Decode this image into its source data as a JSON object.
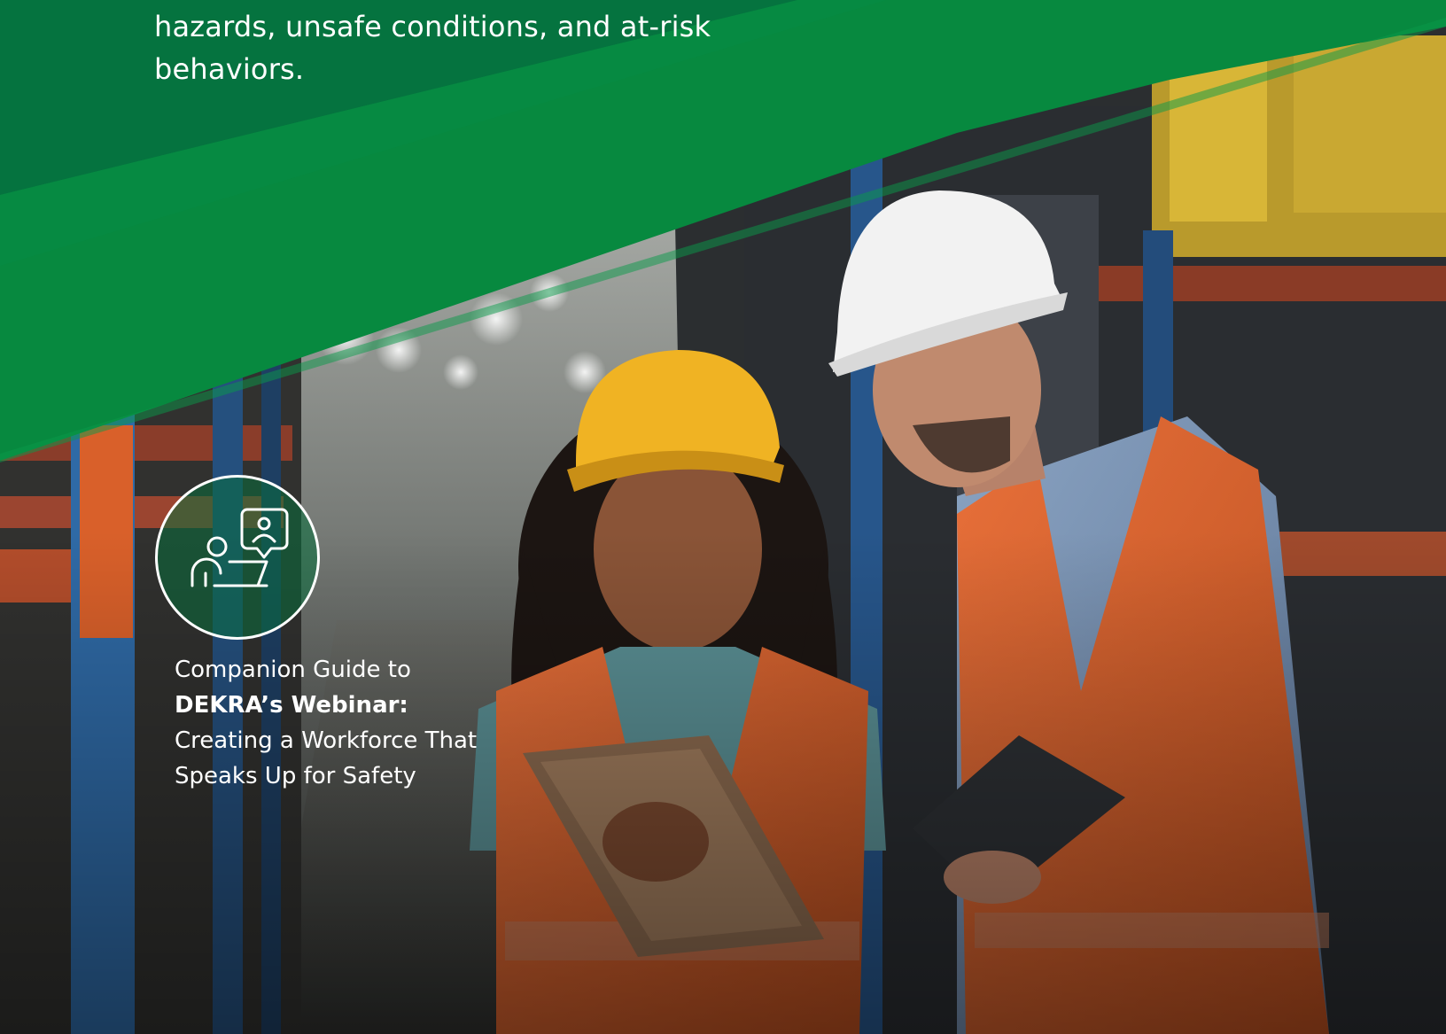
{
  "intro": {
    "line1": "hazards, unsafe conditions, and at-risk",
    "line2": "behaviors."
  },
  "companion": {
    "line1": "Companion Guide to",
    "line2": "DEKRA’s Webinar:",
    "line3": "Creating a Workforce That",
    "line4": "Speaks Up for Safety"
  },
  "icons": {
    "badge": "person-with-laptop-and-speech-bubble-icon"
  },
  "colors": {
    "brand_green": "#07893f",
    "brand_green_dark": "#05733f",
    "vest_orange": "#e0662a",
    "helmet_yellow": "#f0b323",
    "helmet_white": "#f2f2f2"
  }
}
